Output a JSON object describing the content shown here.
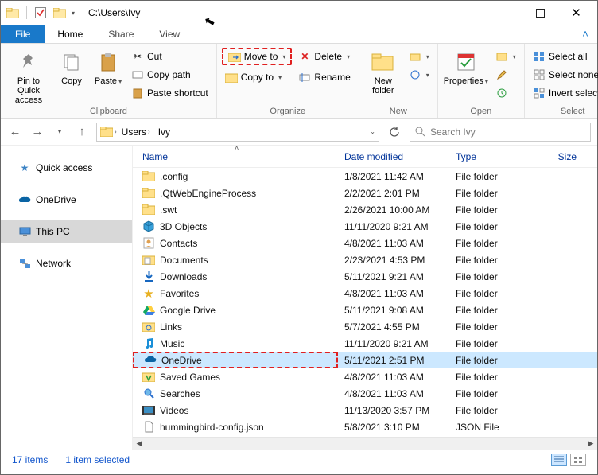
{
  "title": "C:\\Users\\Ivy",
  "tabs": {
    "file": "File",
    "home": "Home",
    "share": "Share",
    "view": "View"
  },
  "ribbon": {
    "clipboard": {
      "label": "Clipboard",
      "pin": "Pin to Quick access",
      "copy": "Copy",
      "paste": "Paste",
      "cut": "Cut",
      "copypath": "Copy path",
      "pasteshortcut": "Paste shortcut"
    },
    "organize": {
      "label": "Organize",
      "moveto": "Move to",
      "copyto": "Copy to",
      "delete": "Delete",
      "rename": "Rename"
    },
    "new": {
      "label": "New",
      "newfolder": "New folder"
    },
    "open": {
      "label": "Open",
      "properties": "Properties"
    },
    "select": {
      "label": "Select",
      "all": "Select all",
      "none": "Select none",
      "invert": "Invert selection"
    }
  },
  "breadcrumb": {
    "a": "Users",
    "b": "Ivy"
  },
  "search_placeholder": "Search Ivy",
  "nav": {
    "quick": "Quick access",
    "onedrive": "OneDrive",
    "thispc": "This PC",
    "network": "Network"
  },
  "columns": {
    "name": "Name",
    "date": "Date modified",
    "type": "Type",
    "size": "Size"
  },
  "rows": [
    {
      "name": ".config",
      "date": "1/8/2021 11:42 AM",
      "type": "File folder",
      "icon": "folder"
    },
    {
      "name": ".QtWebEngineProcess",
      "date": "2/2/2021 2:01 PM",
      "type": "File folder",
      "icon": "folder"
    },
    {
      "name": ".swt",
      "date": "2/26/2021 10:00 AM",
      "type": "File folder",
      "icon": "folder"
    },
    {
      "name": "3D Objects",
      "date": "11/11/2020 9:21 AM",
      "type": "File folder",
      "icon": "3d"
    },
    {
      "name": "Contacts",
      "date": "4/8/2021 11:03 AM",
      "type": "File folder",
      "icon": "contacts"
    },
    {
      "name": "Documents",
      "date": "2/23/2021 4:53 PM",
      "type": "File folder",
      "icon": "docs"
    },
    {
      "name": "Downloads",
      "date": "5/11/2021 9:21 AM",
      "type": "File folder",
      "icon": "downloads"
    },
    {
      "name": "Favorites",
      "date": "4/8/2021 11:03 AM",
      "type": "File folder",
      "icon": "star"
    },
    {
      "name": "Google Drive",
      "date": "5/11/2021 9:08 AM",
      "type": "File folder",
      "icon": "gdrive"
    },
    {
      "name": "Links",
      "date": "5/7/2021 4:55 PM",
      "type": "File folder",
      "icon": "links"
    },
    {
      "name": "Music",
      "date": "11/11/2020 9:21 AM",
      "type": "File folder",
      "icon": "music"
    },
    {
      "name": "OneDrive",
      "date": "5/11/2021 2:51 PM",
      "type": "File folder",
      "icon": "onedrive",
      "selected": true,
      "highlight": true
    },
    {
      "name": "Saved Games",
      "date": "4/8/2021 11:03 AM",
      "type": "File folder",
      "icon": "games"
    },
    {
      "name": "Searches",
      "date": "4/8/2021 11:03 AM",
      "type": "File folder",
      "icon": "search"
    },
    {
      "name": "Videos",
      "date": "11/13/2020 3:57 PM",
      "type": "File folder",
      "icon": "videos"
    },
    {
      "name": "hummingbird-config.json",
      "date": "5/8/2021 3:10 PM",
      "type": "JSON File",
      "icon": "file"
    }
  ],
  "status": {
    "count": "17 items",
    "sel": "1 item selected"
  }
}
